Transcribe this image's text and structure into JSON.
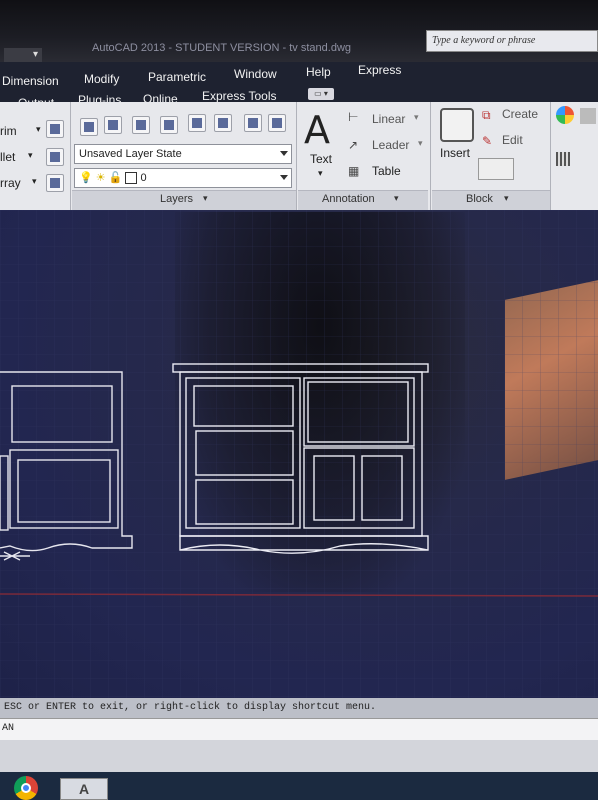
{
  "titlebar": {
    "window_title": "AutoCAD 2013 - STUDENT VERSION - tv stand.dwg",
    "search_placeholder": "Type a keyword or phrase"
  },
  "menus": {
    "row1": [
      "Dimension",
      "Modify",
      "Parametric",
      "Window",
      "Help",
      "Express"
    ],
    "row2": [
      "Output",
      "Plug-ins",
      "Online",
      "Express Tools"
    ]
  },
  "ribbon": {
    "modify_panel": {
      "items": [
        "rim",
        "llet",
        "rray"
      ]
    },
    "layers_panel": {
      "title": "Layers",
      "layer_state": "Unsaved Layer State",
      "current_layer": "0"
    },
    "annotation_panel": {
      "title": "Annotation",
      "text_label": "Text",
      "text_glyph": "A",
      "linear_label": "Linear",
      "leader_label": "Leader",
      "table_label": "Table"
    },
    "block_panel": {
      "title": "Block",
      "insert_label": "Insert",
      "create_label": "Create",
      "edit_label": "Edit"
    }
  },
  "command_line": {
    "prompt_text": "ESC or ENTER to exit, or right-click to display shortcut menu.",
    "input_value": "AN"
  },
  "colors": {
    "canvas_bg": "#232752",
    "drawing_lines": "#e8e8f0",
    "grid_lines": "#3a3f6b",
    "axis_red": "#7a2a3a"
  },
  "icons": [
    "autocad-taskbar-icon",
    "chrome-taskbar-icon"
  ]
}
